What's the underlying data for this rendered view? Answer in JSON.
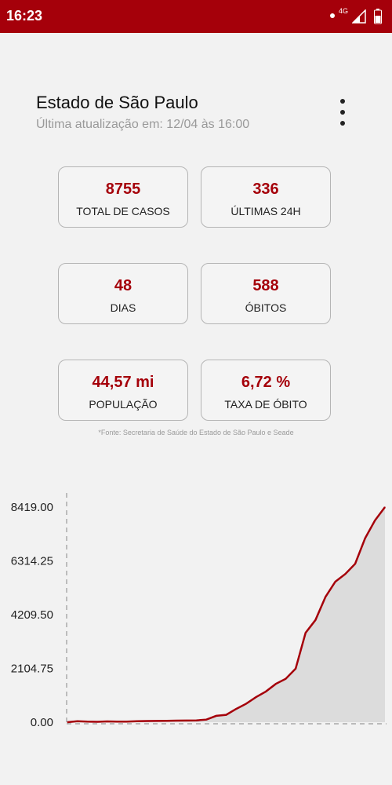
{
  "status_bar": {
    "time": "16:23",
    "network": "4G"
  },
  "header": {
    "title": "Estado de São Paulo",
    "subtitle": "Última atualização em: 12/04 às 16:00"
  },
  "cards": [
    {
      "value": "8755",
      "label": "TOTAL DE CASOS"
    },
    {
      "value": "336",
      "label": "ÚLTIMAS 24H"
    },
    {
      "value": "48",
      "label": "DIAS"
    },
    {
      "value": "588",
      "label": "ÓBITOS"
    },
    {
      "value": "44,57 mi",
      "label": "POPULAÇÃO"
    },
    {
      "value": "6,72 %",
      "label": "TAXA DE ÓBITO"
    }
  ],
  "source_note": "*Fonte: Secretaria de Saúde do Estado de São Paulo e Seade",
  "colors": {
    "accent": "#a5000a",
    "background": "#f2f2f2",
    "fill": "#dcdcdc"
  },
  "icons": {
    "menu": "more-vertical-icon",
    "battery": "battery-icon",
    "signal": "signal-icon"
  },
  "chart_data": {
    "type": "area",
    "y_tick_labels": [
      "8419.00",
      "6314.25",
      "4209.50",
      "2104.75",
      "0.00"
    ],
    "ylim": [
      0,
      8419
    ],
    "grid": false,
    "values": [
      0,
      40,
      20,
      15,
      30,
      20,
      25,
      40,
      45,
      50,
      55,
      60,
      65,
      70,
      100,
      250,
      290,
      520,
      720,
      980,
      1200,
      1500,
      1700,
      2100,
      3500,
      4000,
      4900,
      5500,
      5800,
      6200,
      7200,
      7900,
      8419
    ]
  }
}
